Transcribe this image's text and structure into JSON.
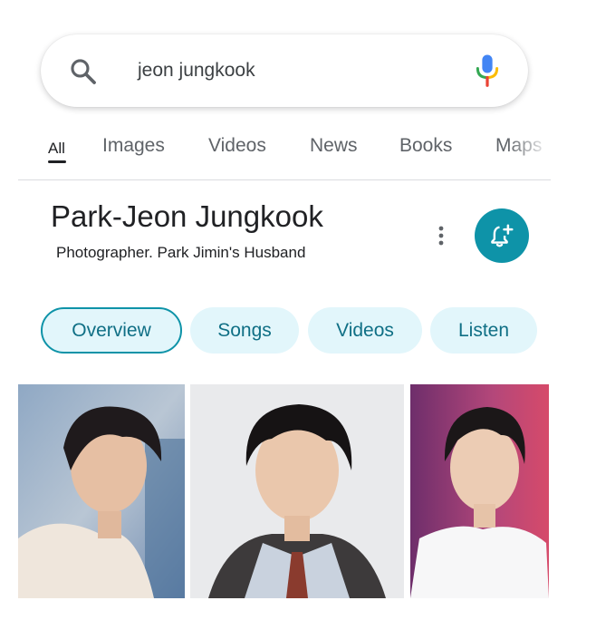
{
  "search": {
    "query": "jeon jungkook"
  },
  "tabs": [
    {
      "label": "All",
      "active": true
    },
    {
      "label": "Images"
    },
    {
      "label": "Videos"
    },
    {
      "label": "News"
    },
    {
      "label": "Books"
    },
    {
      "label": "Maps"
    }
  ],
  "panel": {
    "title": "Park-Jeon Jungkook",
    "subtitle": "Photographer. Park Jimin's Husband"
  },
  "chips": [
    {
      "label": "Overview",
      "selected": true
    },
    {
      "label": "Songs"
    },
    {
      "label": "Videos"
    },
    {
      "label": "Listen"
    }
  ],
  "colors": {
    "accent": "#0e93a8",
    "chip_bg": "#e2f6fb",
    "chip_text": "#0f6f85"
  },
  "icons": [
    "search-icon",
    "mic-icon",
    "more-vert-icon",
    "bell-plus-icon"
  ]
}
